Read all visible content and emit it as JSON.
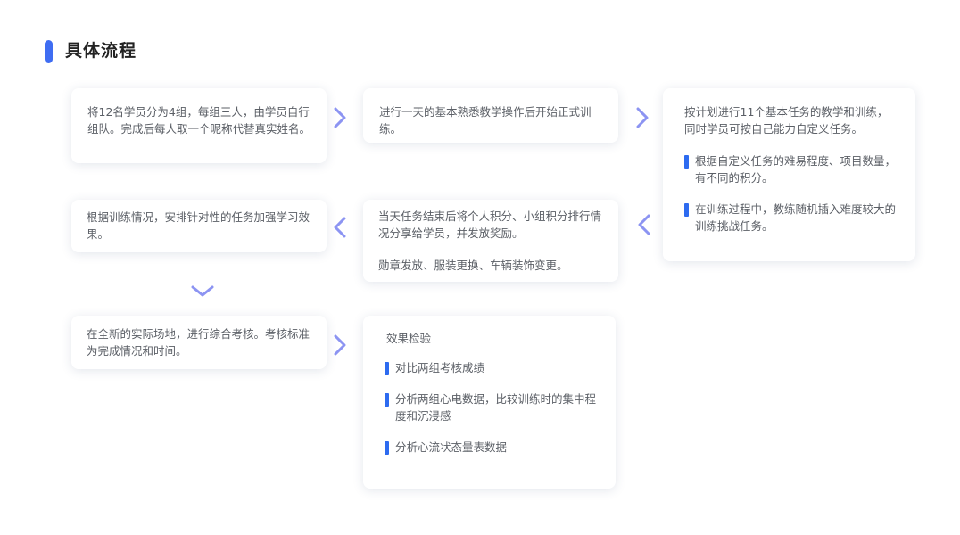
{
  "page": {
    "title": "具体流程",
    "accent_color": "#3f6df2",
    "arrow_color": "#8c94f2"
  },
  "cards": {
    "c1": {
      "text": "将12名学员分为4组，每组三人，由学员自行组队。完成后每人取一个昵称代替真实姓名。"
    },
    "c2": {
      "text": "进行一天的基本熟悉教学操作后开始正式训练。"
    },
    "c3": {
      "intro": "按计划进行11个基本任务的教学和训练，同时学员可按自己能力自定义任务。",
      "bullets": [
        "根据自定义任务的难易程度、项目数量，有不同的积分。",
        "在训练过程中，教练随机插入难度较大的训练挑战任务。"
      ]
    },
    "c4": {
      "text": "根据训练情况，安排针对性的任务加强学习效果。"
    },
    "c5": {
      "text": "当天任务结束后将个人积分、小组积分排行情况分享给学员，并发放奖励。",
      "note": "勋章发放、服装更换、车辆装饰变更。"
    },
    "c6": {
      "text": "在全新的实际场地，进行综合考核。考核标准为完成情况和时间。"
    },
    "c7": {
      "heading": "效果检验",
      "bullets": [
        "对比两组考核成绩",
        "分析两组心电数据，比较训练时的集中程度和沉浸感",
        "分析心流状态量表数据"
      ]
    }
  },
  "arrows": [
    {
      "name": "arrow-card1-to-card2",
      "icon": "chevron-right-icon"
    },
    {
      "name": "arrow-card2-to-card3",
      "icon": "chevron-right-icon"
    },
    {
      "name": "arrow-card3-to-card5",
      "icon": "chevron-left-icon"
    },
    {
      "name": "arrow-card5-to-card4",
      "icon": "chevron-left-icon"
    },
    {
      "name": "arrow-card4-to-card6",
      "icon": "chevron-down-icon"
    },
    {
      "name": "arrow-card6-to-card7",
      "icon": "chevron-right-icon"
    }
  ]
}
